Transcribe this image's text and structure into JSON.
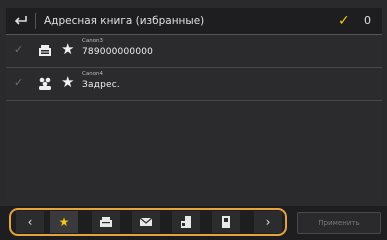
{
  "header": {
    "title": "Адресная книга (избранные)",
    "selected_count": "0"
  },
  "rows": [
    {
      "name": "Canon3",
      "address": "789000000000",
      "type_icon": "fax-icon"
    },
    {
      "name": "Canon4",
      "address": "Задрес.",
      "type_icon": "group-icon"
    }
  ],
  "toolbar": {
    "apply_label": "Применить",
    "buttons": [
      "prev-icon",
      "star-icon",
      "fax-icon",
      "email-icon",
      "file-icon",
      "ifax-icon",
      "next-icon"
    ]
  },
  "colors": {
    "accent": "#f5c518",
    "highlight_border": "#e6a23c"
  }
}
